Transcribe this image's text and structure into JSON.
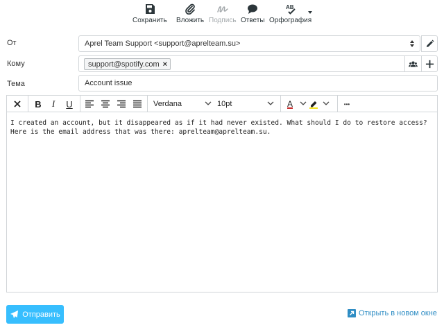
{
  "toolbar": {
    "save": "Сохранить",
    "attach": "Вложить",
    "signature": "Подпись",
    "responses": "Ответы",
    "spell": "Орфография",
    "spell_icon_text": "AB"
  },
  "headers": {
    "from_label": "От",
    "from_value": "Aprel Team Support <support@aprelteam.su>",
    "to_label": "Кому",
    "to_recipient": "support@spotify.com",
    "to_remove": "×",
    "subject_label": "Тема",
    "subject_value": "Account issue"
  },
  "editor": {
    "font_family": "Verdana",
    "font_size": "10pt",
    "bold": "B",
    "italic": "I",
    "underline": "U",
    "text_color_letter": "A",
    "more": "•••",
    "body": "I created an account, but it disappeared as if it had never existed. What should I do to restore access? Here is the email address that was there: aprelteam@aprelteam.su."
  },
  "footer": {
    "send": "Отправить",
    "open_new_window": "Открыть в новом окне"
  },
  "colors": {
    "accent": "#37befe",
    "link": "#2f8dc4",
    "border": "#d1d5d8",
    "text_color_bar": "#c62828",
    "highlight_bar": "#f4e21b"
  }
}
